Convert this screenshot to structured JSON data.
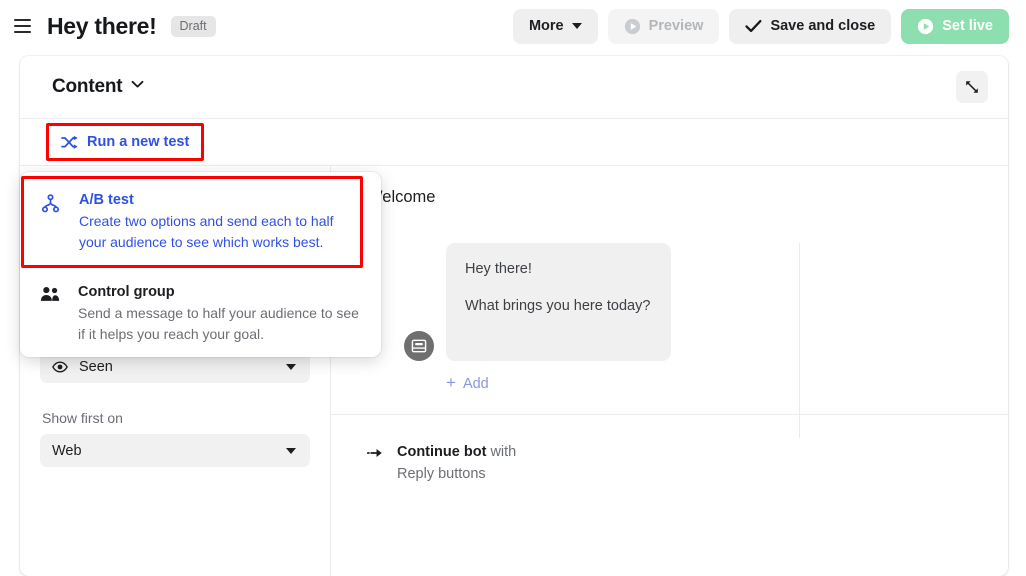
{
  "topbar": {
    "menu_icon": "hamburger-icon",
    "title": "Hey there!",
    "status_badge": "Draft",
    "buttons": {
      "more": "More",
      "preview": "Preview",
      "save_and_close": "Save and close",
      "set_live": "Set live"
    }
  },
  "card": {
    "header_title": "Content",
    "expand_icon": "expand-diagonal-icon",
    "run_test_label": "Run a new test",
    "run_test_icon": "ab-shuffle-icon"
  },
  "popup": {
    "items": [
      {
        "icon": "branch-fork-icon",
        "title": "A/B test",
        "description": "Create two options and send each to half your audience to see which works best."
      },
      {
        "icon": "people-group-icon",
        "title": "Control group",
        "description": "Send a message to half your audience to see if it helps you reach your goal."
      }
    ]
  },
  "left_pane": {
    "seen_select": {
      "value": "Seen",
      "icon": "eye-icon"
    },
    "show_first_label": "Show first on",
    "platform_select": {
      "value": "Web"
    }
  },
  "right_pane": {
    "section_title": "Welcome",
    "bubble": {
      "avatar_icon": "chat-box-icon",
      "lines": [
        "Hey there!",
        "What brings you here today?"
      ]
    },
    "add_label": "Add",
    "continue": {
      "icon": "arrow-forward-icon",
      "strong": "Continue bot",
      "with": "with",
      "sub": "Reply buttons"
    }
  },
  "colors": {
    "accent_blue": "#2f51e2",
    "highlight_red": "#ff0000",
    "set_live_green": "#8edfb0",
    "bubble_grey": "#f0f0f0",
    "add_link": "#8a93e8"
  }
}
